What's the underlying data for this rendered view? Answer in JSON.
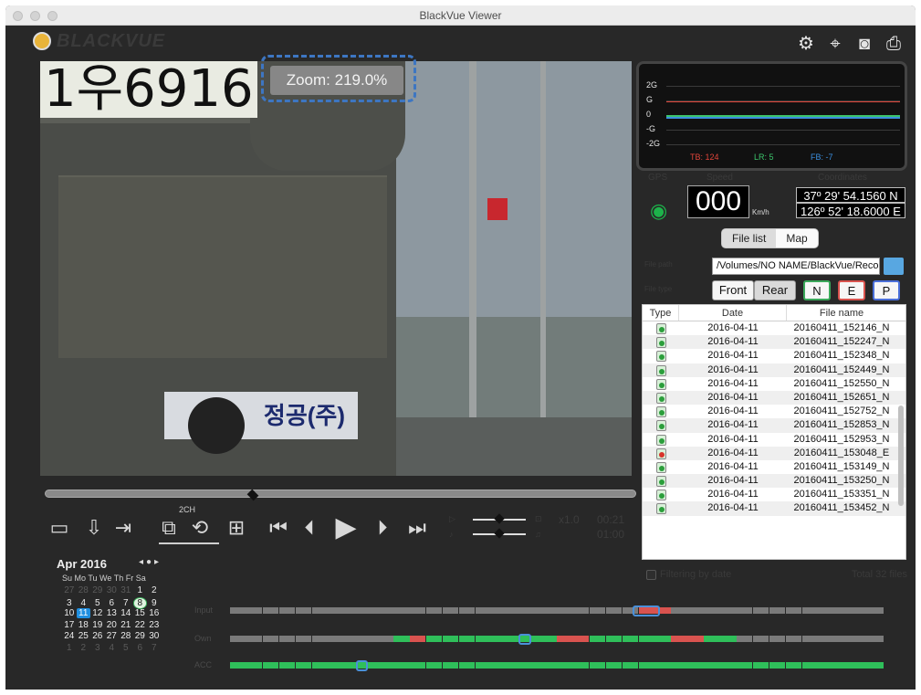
{
  "window": {
    "title": "BlackVue Viewer"
  },
  "brand": {
    "name": "BLACKVUE"
  },
  "toolbar_top": {
    "icons": [
      "settings-icon",
      "gps-icon",
      "camera-icon",
      "print-icon"
    ]
  },
  "video": {
    "plate_text": "1우6916",
    "sticker_text": "정공(주)",
    "zoom_label": "Zoom: 219.0%"
  },
  "gsensor": {
    "labels": [
      "2G",
      "G",
      "0",
      "-G",
      "-2G"
    ],
    "tb": "TB: 124",
    "lr": "LR: 5",
    "fb": "FB: -7",
    "colors": {
      "tb": "#e0453a",
      "lr": "#3cc46b",
      "fb": "#3b8fe0"
    }
  },
  "gps": {
    "gps_label": "GPS",
    "speed_label": "Speed",
    "coord_label": "Coordinates",
    "speed": "000",
    "unit": "Km/h",
    "lat": "37º 29' 54.1560 N",
    "lon": "126º 52' 18.6000 E"
  },
  "tabs": {
    "file_list": "File list",
    "map": "Map"
  },
  "filepath": {
    "label": "File path",
    "value": "/Volumes/NO NAME/BlackVue/Record",
    "type_label": "File type"
  },
  "filetype": {
    "front": "Front",
    "rear": "Rear",
    "n": "N",
    "e": "E",
    "p": "P"
  },
  "table": {
    "headers": [
      "Type",
      "Date",
      "File name"
    ],
    "rows": [
      {
        "type": "N",
        "date": "2016-04-11",
        "name": "20160411_152146_N"
      },
      {
        "type": "N",
        "date": "2016-04-11",
        "name": "20160411_152247_N"
      },
      {
        "type": "N",
        "date": "2016-04-11",
        "name": "20160411_152348_N"
      },
      {
        "type": "N",
        "date": "2016-04-11",
        "name": "20160411_152449_N"
      },
      {
        "type": "N",
        "date": "2016-04-11",
        "name": "20160411_152550_N"
      },
      {
        "type": "N",
        "date": "2016-04-11",
        "name": "20160411_152651_N"
      },
      {
        "type": "N",
        "date": "2016-04-11",
        "name": "20160411_152752_N"
      },
      {
        "type": "N",
        "date": "2016-04-11",
        "name": "20160411_152853_N"
      },
      {
        "type": "N",
        "date": "2016-04-11",
        "name": "20160411_152953_N"
      },
      {
        "type": "E",
        "date": "2016-04-11",
        "name": "20160411_153048_E"
      },
      {
        "type": "N",
        "date": "2016-04-11",
        "name": "20160411_153149_N"
      },
      {
        "type": "N",
        "date": "2016-04-11",
        "name": "20160411_153250_N"
      },
      {
        "type": "N",
        "date": "2016-04-11",
        "name": "20160411_153351_N"
      },
      {
        "type": "N",
        "date": "2016-04-11",
        "name": "20160411_153452_N"
      }
    ]
  },
  "filter": {
    "label": "Filtering by date",
    "total": "Total 32 files"
  },
  "player": {
    "ch_label": "2CH",
    "speed_label": "x1.0",
    "time": "00:21",
    "time2": "01:00"
  },
  "calendar": {
    "title": "Apr 2016",
    "weekdays": "Su Mo Tu We Th Fr Sa",
    "weeks": [
      [
        "27",
        "28",
        "29",
        "30",
        "31",
        "1",
        "2"
      ],
      [
        "3",
        "4",
        "5",
        "6",
        "7",
        "8",
        "9"
      ],
      [
        "10",
        "11",
        "12",
        "13",
        "14",
        "15",
        "16"
      ],
      [
        "17",
        "18",
        "19",
        "20",
        "21",
        "22",
        "23"
      ],
      [
        "24",
        "25",
        "26",
        "27",
        "28",
        "29",
        "30"
      ],
      [
        "1",
        "2",
        "3",
        "4",
        "5",
        "6",
        "7"
      ]
    ],
    "selected": "11",
    "highlighted": "8"
  },
  "timeline": {
    "labels": [
      "Input",
      "Own",
      "ACC"
    ],
    "colors": {
      "normal": "#2fbf5a",
      "event": "#d9534f",
      "off": "#7a7a7a",
      "select": "#4a90d9"
    }
  }
}
